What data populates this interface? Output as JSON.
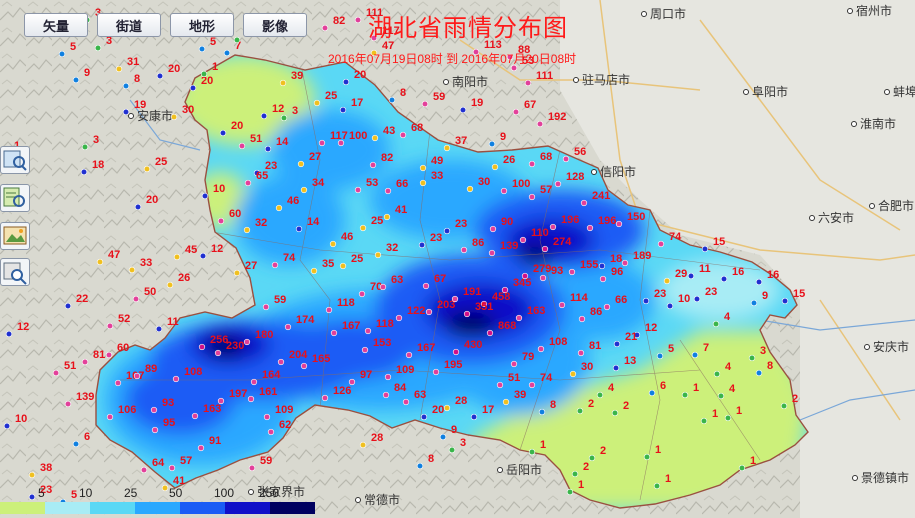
{
  "title": "湖北省雨情分布图",
  "subtitle": "2016年07月19日08时  到  2016年07月20日08时",
  "toolbar": {
    "buttons": [
      "矢量",
      "街道",
      "地形",
      "影像"
    ]
  },
  "side_tools": [
    "zoom-query-icon",
    "layer-search-icon",
    "picture-icon",
    "route-icon"
  ],
  "legend": {
    "labels": [
      "5",
      "10",
      "25",
      "50",
      "100",
      "250"
    ],
    "colors": [
      "#ccf07a",
      "#a8ecf5",
      "#5ad8f5",
      "#2aa8ff",
      "#1a5cf5",
      "#1010c8",
      "#000060"
    ]
  },
  "cities": [
    "南阳市",
    "周口市",
    "宿州市",
    "驻马店市",
    "阜阳市",
    "淮南市",
    "蚌埠",
    "信阳市",
    "六安市",
    "合肥市",
    "安庆市",
    "安康市",
    "常德市",
    "岳阳市",
    "景德镇市",
    "张家界市"
  ],
  "stations": [
    [
      "3",
      95,
      12
    ],
    [
      "5",
      70,
      46
    ],
    [
      "9",
      84,
      72
    ],
    [
      "3",
      106,
      40
    ],
    [
      "31",
      127,
      61
    ],
    [
      "8",
      134,
      78
    ],
    [
      "20",
      168,
      68
    ],
    [
      "30",
      182,
      109
    ],
    [
      "19",
      134,
      104
    ],
    [
      "20",
      201,
      80
    ],
    [
      "7",
      235,
      45
    ],
    [
      "5",
      210,
      41
    ],
    [
      "1",
      245,
      32
    ],
    [
      "1",
      212,
      66
    ],
    [
      "82",
      333,
      20
    ],
    [
      "111",
      366,
      12
    ],
    [
      "117",
      382,
      30
    ],
    [
      "47",
      382,
      45
    ],
    [
      "113",
      484,
      44
    ],
    [
      "88",
      518,
      49
    ],
    [
      "53",
      522,
      60
    ],
    [
      "111",
      536,
      75
    ],
    [
      "67",
      524,
      104
    ],
    [
      "192",
      548,
      116
    ],
    [
      "20",
      354,
      74
    ],
    [
      "8",
      400,
      92
    ],
    [
      "59",
      433,
      96
    ],
    [
      "19",
      471,
      102
    ],
    [
      "9",
      500,
      136
    ],
    [
      "39",
      291,
      75
    ],
    [
      "25",
      325,
      95
    ],
    [
      "17",
      351,
      102
    ],
    [
      "12",
      272,
      108
    ],
    [
      "3",
      292,
      110
    ],
    [
      "20",
      231,
      125
    ],
    [
      "51",
      250,
      138
    ],
    [
      "14",
      276,
      141
    ],
    [
      "43",
      383,
      130
    ],
    [
      "68",
      411,
      127
    ],
    [
      "37",
      455,
      140
    ],
    [
      "26",
      503,
      159
    ],
    [
      "68",
      540,
      156
    ],
    [
      "56",
      574,
      151
    ],
    [
      "117",
      330,
      135
    ],
    [
      "100",
      349,
      135
    ],
    [
      "27",
      309,
      156
    ],
    [
      "82",
      381,
      157
    ],
    [
      "49",
      431,
      160
    ],
    [
      "23",
      265,
      165
    ],
    [
      "65",
      256,
      175
    ],
    [
      "34",
      312,
      182
    ],
    [
      "53",
      366,
      182
    ],
    [
      "66",
      396,
      183
    ],
    [
      "33",
      431,
      175
    ],
    [
      "30",
      478,
      181
    ],
    [
      "100",
      512,
      183
    ],
    [
      "57",
      540,
      189
    ],
    [
      "128",
      566,
      176
    ],
    [
      "241",
      592,
      195
    ],
    [
      "10",
      213,
      188
    ],
    [
      "46",
      287,
      200
    ],
    [
      "41",
      395,
      209
    ],
    [
      "60",
      229,
      213
    ],
    [
      "32",
      255,
      222
    ],
    [
      "14",
      307,
      221
    ],
    [
      "25",
      371,
      220
    ],
    [
      "23",
      455,
      223
    ],
    [
      "90",
      501,
      221
    ],
    [
      "196",
      561,
      219
    ],
    [
      "196",
      598,
      220
    ],
    [
      "150",
      627,
      216
    ],
    [
      "110",
      531,
      232
    ],
    [
      "274",
      553,
      241
    ],
    [
      "46",
      341,
      236
    ],
    [
      "32",
      386,
      247
    ],
    [
      "23",
      430,
      237
    ],
    [
      "86",
      472,
      242
    ],
    [
      "139",
      500,
      245
    ],
    [
      "155",
      580,
      264
    ],
    [
      "18",
      610,
      258
    ],
    [
      "96",
      611,
      271
    ],
    [
      "189",
      633,
      255
    ],
    [
      "74",
      669,
      236
    ],
    [
      "15",
      713,
      241
    ],
    [
      "74",
      283,
      257
    ],
    [
      "25",
      351,
      258
    ],
    [
      "35",
      322,
      263
    ],
    [
      "70",
      370,
      286
    ],
    [
      "63",
      391,
      279
    ],
    [
      "67",
      434,
      278
    ],
    [
      "345",
      513,
      282
    ],
    [
      "279",
      533,
      268
    ],
    [
      "93",
      551,
      270
    ],
    [
      "29",
      675,
      273
    ],
    [
      "11",
      699,
      268
    ],
    [
      "16",
      732,
      271
    ],
    [
      "16",
      767,
      274
    ],
    [
      "27",
      245,
      265
    ],
    [
      "9",
      762,
      295
    ],
    [
      "15",
      793,
      293
    ],
    [
      "23",
      654,
      293
    ],
    [
      "10",
      678,
      298
    ],
    [
      "23",
      705,
      291
    ],
    [
      "114",
      570,
      297
    ],
    [
      "66",
      615,
      299
    ],
    [
      "59",
      274,
      299
    ],
    [
      "118",
      337,
      302
    ],
    [
      "122",
      407,
      310
    ],
    [
      "203",
      437,
      304
    ],
    [
      "191",
      463,
      291
    ],
    [
      "458",
      492,
      296
    ],
    [
      "351",
      475,
      306
    ],
    [
      "163",
      527,
      310
    ],
    [
      "86",
      590,
      311
    ],
    [
      "4",
      724,
      316
    ],
    [
      "174",
      296,
      319
    ],
    [
      "167",
      342,
      325
    ],
    [
      "118",
      376,
      323
    ],
    [
      "868",
      498,
      325
    ],
    [
      "12",
      645,
      327
    ],
    [
      "180",
      255,
      334
    ],
    [
      "230",
      226,
      345
    ],
    [
      "256",
      210,
      339
    ],
    [
      "153",
      373,
      342
    ],
    [
      "167",
      417,
      347
    ],
    [
      "430",
      464,
      344
    ],
    [
      "108",
      549,
      341
    ],
    [
      "81",
      589,
      345
    ],
    [
      "21",
      625,
      336
    ],
    [
      "5",
      668,
      348
    ],
    [
      "7",
      703,
      347
    ],
    [
      "3",
      760,
      350
    ],
    [
      "204",
      289,
      354
    ],
    [
      "165",
      312,
      358
    ],
    [
      "195",
      444,
      364
    ],
    [
      "79",
      522,
      356
    ],
    [
      "13",
      624,
      360
    ],
    [
      "4",
      725,
      366
    ],
    [
      "8",
      767,
      365
    ],
    [
      "164",
      262,
      374
    ],
    [
      "97",
      360,
      374
    ],
    [
      "109",
      396,
      369
    ],
    [
      "51",
      508,
      377
    ],
    [
      "74",
      540,
      377
    ],
    [
      "30",
      581,
      366
    ],
    [
      "107",
      126,
      375
    ],
    [
      "89",
      145,
      368
    ],
    [
      "108",
      184,
      371
    ],
    [
      "197",
      229,
      393
    ],
    [
      "161",
      259,
      391
    ],
    [
      "126",
      333,
      390
    ],
    [
      "84",
      394,
      387
    ],
    [
      "63",
      414,
      394
    ],
    [
      "39",
      514,
      394
    ],
    [
      "4",
      608,
      387
    ],
    [
      "6",
      660,
      385
    ],
    [
      "1",
      693,
      387
    ],
    [
      "4",
      729,
      388
    ],
    [
      "93",
      162,
      402
    ],
    [
      "163",
      203,
      408
    ],
    [
      "109",
      275,
      409
    ],
    [
      "20",
      432,
      409
    ],
    [
      "28",
      455,
      400
    ],
    [
      "17",
      482,
      409
    ],
    [
      "8",
      550,
      404
    ],
    [
      "2",
      588,
      403
    ],
    [
      "2",
      623,
      405
    ],
    [
      "106",
      118,
      409
    ],
    [
      "95",
      163,
      422
    ],
    [
      "62",
      279,
      424
    ],
    [
      "9",
      451,
      429
    ],
    [
      "3",
      460,
      442
    ],
    [
      "1",
      712,
      413
    ],
    [
      "1",
      736,
      410
    ],
    [
      "2",
      792,
      398
    ],
    [
      "91",
      209,
      440
    ],
    [
      "28",
      371,
      437
    ],
    [
      "1",
      540,
      444
    ],
    [
      "2",
      600,
      450
    ],
    [
      "1",
      655,
      449
    ],
    [
      "64",
      152,
      462
    ],
    [
      "57",
      180,
      460
    ],
    [
      "59",
      260,
      460
    ],
    [
      "8",
      428,
      458
    ],
    [
      "2",
      583,
      466
    ],
    [
      "41",
      173,
      480
    ],
    [
      "38",
      40,
      467
    ],
    [
      "23",
      40,
      489
    ],
    [
      "5",
      71,
      494
    ],
    [
      "1",
      578,
      484
    ],
    [
      "1",
      665,
      478
    ],
    [
      "1",
      750,
      460
    ],
    [
      "22",
      76,
      298
    ],
    [
      "52",
      118,
      318
    ],
    [
      "60",
      117,
      347
    ],
    [
      "81",
      93,
      354
    ],
    [
      "139",
      76,
      396
    ],
    [
      "11",
      167,
      321
    ],
    [
      "12",
      17,
      326
    ],
    [
      "45",
      185,
      249
    ],
    [
      "12",
      211,
      248
    ],
    [
      "47",
      108,
      254
    ],
    [
      "33",
      140,
      262
    ],
    [
      "26",
      178,
      277
    ],
    [
      "50",
      144,
      291
    ],
    [
      "20",
      146,
      199
    ],
    [
      "25",
      155,
      161
    ],
    [
      "18",
      92,
      164
    ],
    [
      "3",
      93,
      139
    ],
    [
      "1",
      14,
      145
    ],
    [
      "51",
      64,
      365
    ],
    [
      "10",
      15,
      418
    ],
    [
      "6",
      84,
      436
    ]
  ]
}
